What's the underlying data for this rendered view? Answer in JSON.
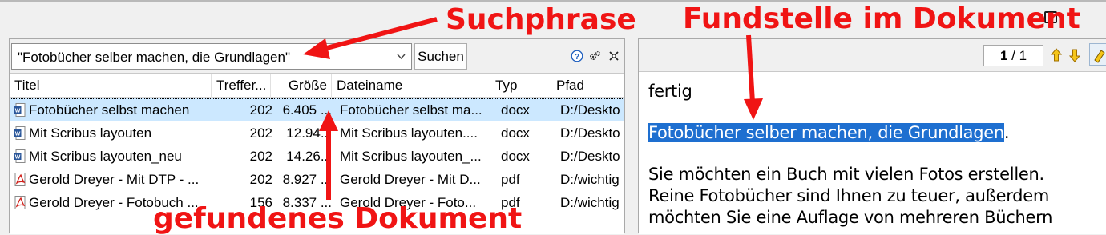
{
  "search": {
    "value": "\"Fotobücher selber machen, die Grundlagen\"",
    "button_label": "Suchen"
  },
  "toolbar_icons": [
    "help-icon",
    "settings-icon",
    "close-panel-icon"
  ],
  "table": {
    "columns": [
      "Titel",
      "Treffer...",
      "Größe",
      "Dateiname",
      "Typ",
      "Pfad"
    ],
    "rows": [
      {
        "icon": "word-doc-icon",
        "title": "Fotobücher selbst machen",
        "hits": "202",
        "size": "6.405 ...",
        "filename": "Fotobücher selbst ma...",
        "type": "docx",
        "path": "D:/Deskto",
        "selected": true
      },
      {
        "icon": "word-doc-icon",
        "title": "Mit Scribus layouten",
        "hits": "202",
        "size": "12.94...",
        "filename": "Mit Scribus layouten....",
        "type": "docx",
        "path": "D:/Deskto",
        "selected": false
      },
      {
        "icon": "word-doc-icon",
        "title": "Mit Scribus layouten_neu",
        "hits": "202",
        "size": "14.26...",
        "filename": "Mit Scribus layouten_...",
        "type": "docx",
        "path": "D:/Deskto",
        "selected": false
      },
      {
        "icon": "pdf-icon",
        "title": "Gerold Dreyer - Mit DTP - ...",
        "hits": "202",
        "size": "8.927 ...",
        "filename": "Gerold Dreyer - Mit D...",
        "type": "pdf",
        "path": "D:/wichtig",
        "selected": false
      },
      {
        "icon": "pdf-icon",
        "title": "Gerold Dreyer - Fotobuch ...",
        "hits": "156",
        "size": "8.337 ...",
        "filename": "Gerold Dreyer - Foto...",
        "type": "pdf",
        "path": "D:/wichtig",
        "selected": false
      }
    ]
  },
  "preview": {
    "pager_current": "1",
    "pager_sep": " / ",
    "pager_total": "1",
    "line1": "fertig",
    "highlight": "Fotobücher selber machen, die Grundlagen",
    "highlight_tail": ".",
    "line3": "Sie möchten ein Buch mit vielen Fotos erstellen.",
    "line4": "Reine Fotobücher sind Ihnen zu teuer, außerdem",
    "line5": "möchten Sie eine Auflage von mehreren Büchern"
  },
  "annotations": {
    "suchphrase": "Suchphrase",
    "fundstelle": "Fundstelle im Dokument",
    "gefunden": "gefundenes Dokument",
    "color": "#f01414"
  },
  "colors": {
    "selection": "#cce8ff",
    "highlight": "#1e6fd0"
  }
}
